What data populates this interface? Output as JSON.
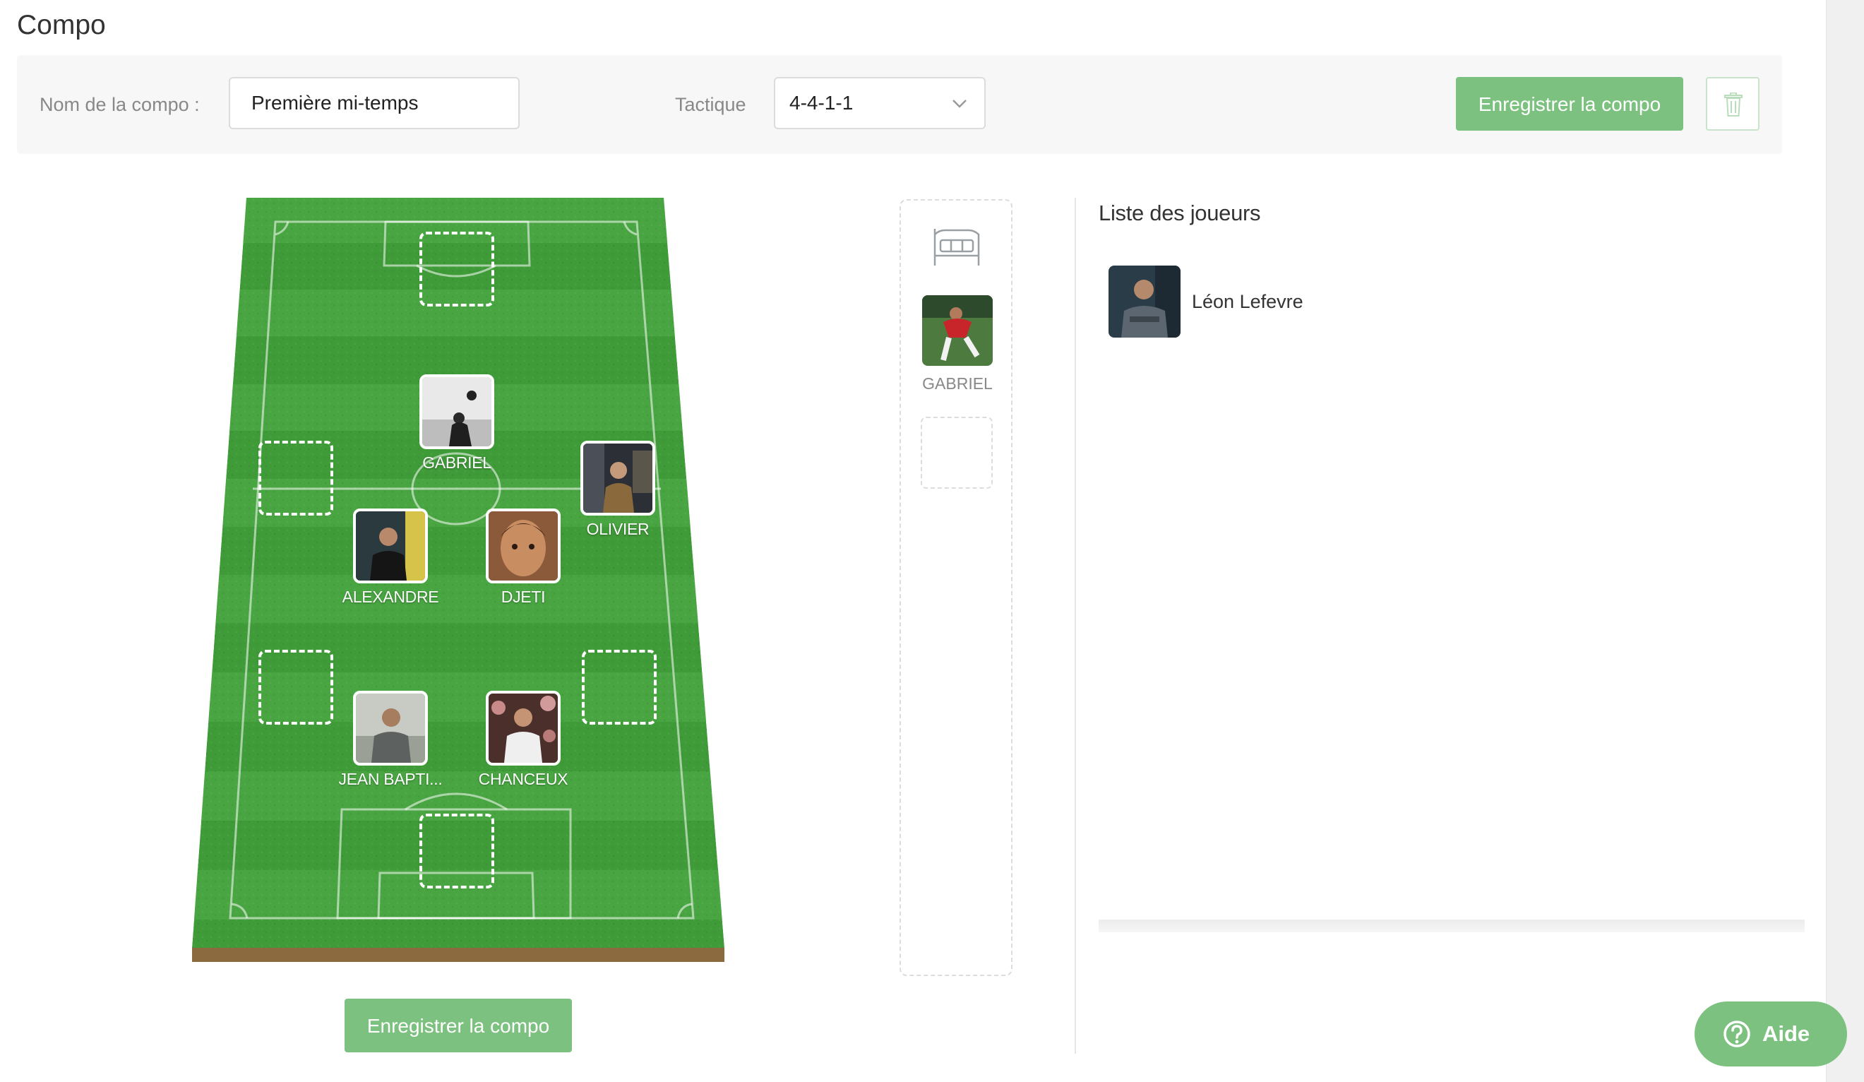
{
  "page": {
    "title": "Compo"
  },
  "toolbar": {
    "name_label": "Nom de la compo :",
    "name_value": "Première mi-temps",
    "tactic_label": "Tactique",
    "tactic_value": "4-4-1-1",
    "save_label": "Enregistrer la compo",
    "delete_icon": "trash-icon"
  },
  "pitch": {
    "players": [
      {
        "position": "second-striker",
        "name": "GABRIEL"
      },
      {
        "position": "right-midfield",
        "name": "OLIVIER"
      },
      {
        "position": "left-center-midfield",
        "name": "ALEXANDRE"
      },
      {
        "position": "right-center-midfield",
        "name": "DJETI"
      },
      {
        "position": "left-center-back",
        "name": "JEAN BAPTI..."
      },
      {
        "position": "right-center-back",
        "name": "CHANCEUX"
      }
    ],
    "empty_slots": [
      "striker",
      "left-midfield",
      "left-back",
      "right-back",
      "goalkeeper"
    ]
  },
  "bottom_save_label": "Enregistrer la compo",
  "bench": {
    "icon": "bed-icon",
    "players": [
      {
        "name": "GABRIEL"
      }
    ]
  },
  "player_list": {
    "title": "Liste des joueurs",
    "players": [
      {
        "name": "Léon Lefevre"
      }
    ]
  },
  "help": {
    "label": "Aide",
    "icon": "question-circle-icon"
  },
  "colors": {
    "accent": "#7cc17f",
    "pitch": "#3f9a38",
    "pitch_base": "#8a6a3e"
  }
}
